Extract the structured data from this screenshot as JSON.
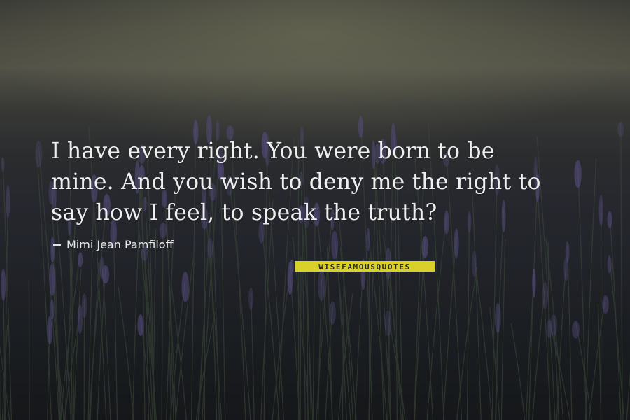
{
  "quote": {
    "lines": [
      "I have every right. You were born to be",
      "mine. And you wish to deny me the right to",
      "say how I feel, to speak the truth?"
    ],
    "author": "Mimi Jean Pamfiloff"
  },
  "watermark": {
    "text": "WISEFAMOUSQUOTES",
    "color": "#d9d12a"
  },
  "palette": {
    "lavender": "#5a4f86",
    "stem": "#3d4a3a"
  }
}
